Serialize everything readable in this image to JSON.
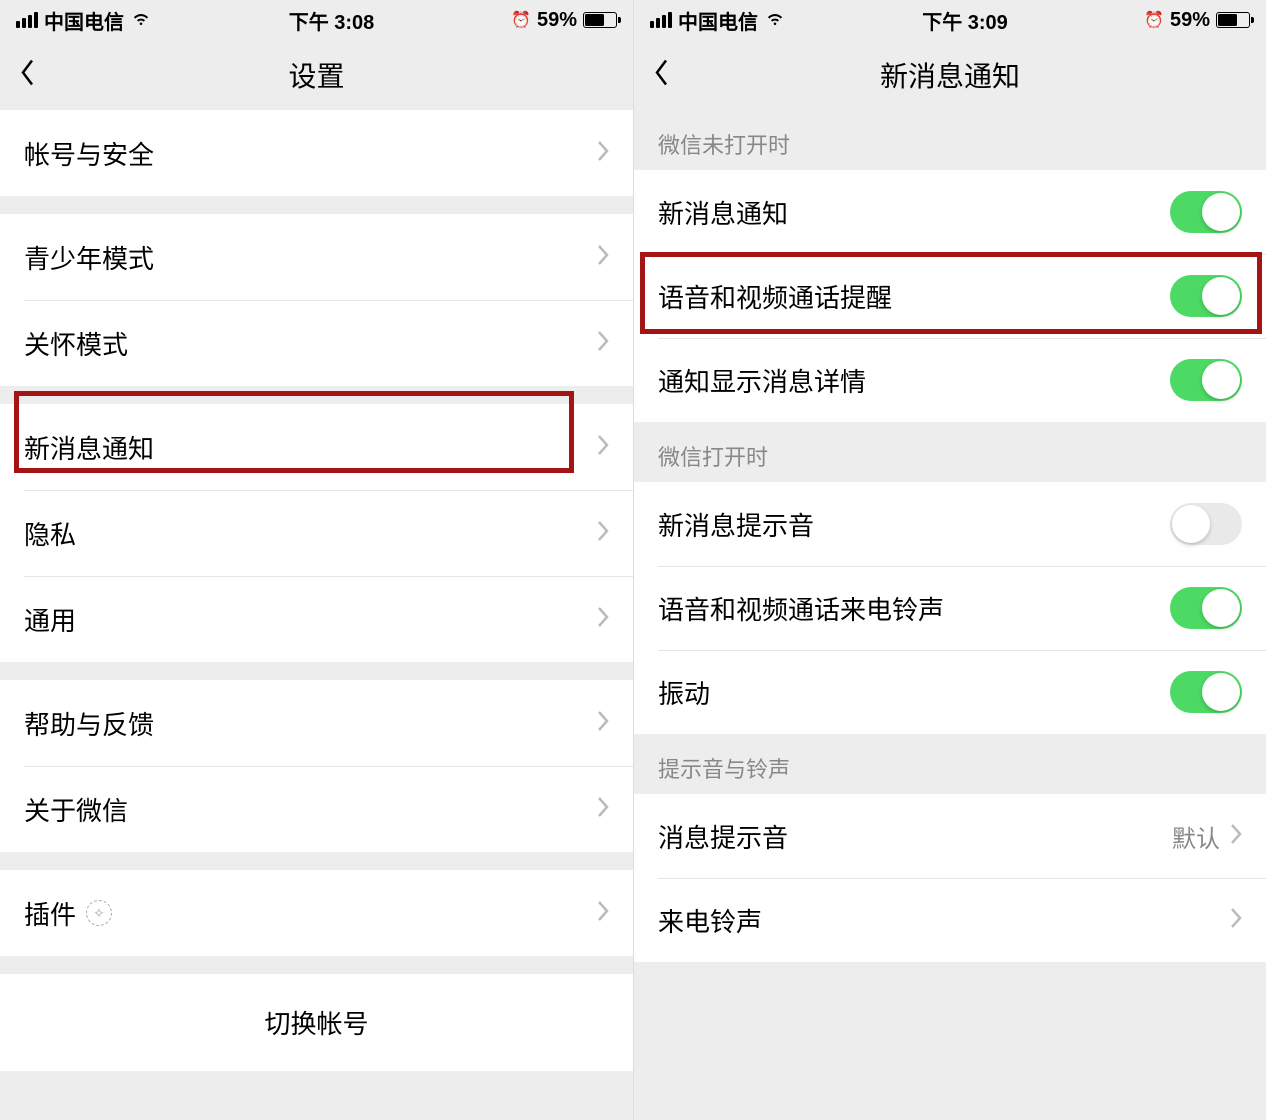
{
  "left": {
    "status": {
      "carrier": "中国电信",
      "time": "下午 3:08",
      "battery": "59%"
    },
    "nav_title": "设置",
    "groups": [
      [
        {
          "label": "帐号与安全"
        }
      ],
      [
        {
          "label": "青少年模式"
        },
        {
          "label": "关怀模式"
        }
      ],
      [
        {
          "label": "新消息通知"
        },
        {
          "label": "隐私"
        },
        {
          "label": "通用"
        }
      ],
      [
        {
          "label": "帮助与反馈"
        },
        {
          "label": "关于微信"
        }
      ],
      [
        {
          "label": "插件",
          "plugin": true
        }
      ]
    ],
    "switch_account": "切换帐号"
  },
  "right": {
    "status": {
      "carrier": "中国电信",
      "time": "下午 3:09",
      "battery": "59%"
    },
    "nav_title": "新消息通知",
    "sections": [
      {
        "header": "微信未打开时",
        "items": [
          {
            "label": "新消息通知",
            "on": true
          },
          {
            "label": "语音和视频通话提醒",
            "on": true
          },
          {
            "label": "通知显示消息详情",
            "on": true
          }
        ]
      },
      {
        "header": "微信打开时",
        "items": [
          {
            "label": "新消息提示音",
            "on": false
          },
          {
            "label": "语音和视频通话来电铃声",
            "on": true
          },
          {
            "label": "振动",
            "on": true
          }
        ]
      },
      {
        "header": "提示音与铃声",
        "items": [
          {
            "label": "消息提示音",
            "value": "默认"
          },
          {
            "label": "来电铃声"
          }
        ]
      }
    ]
  }
}
